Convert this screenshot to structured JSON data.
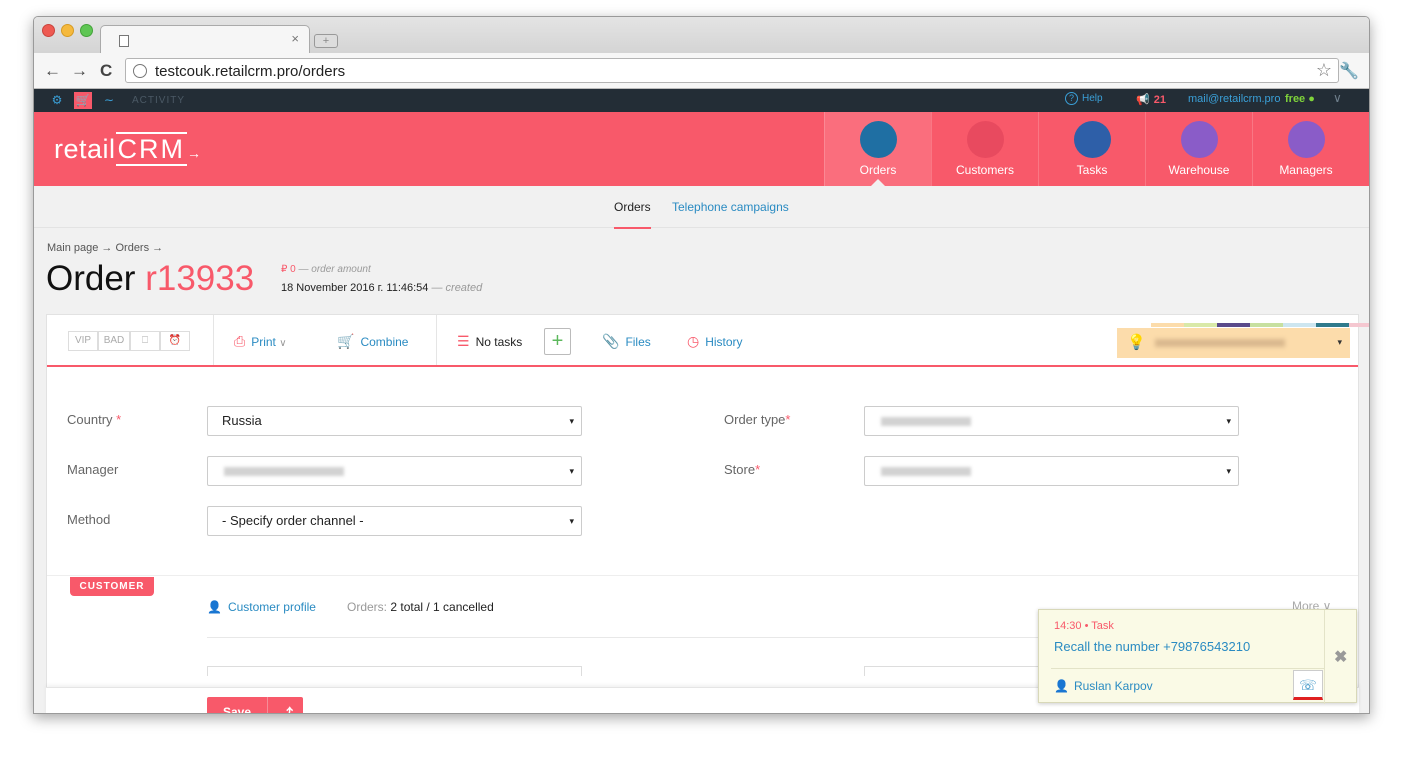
{
  "browser": {
    "url": "testcouk.retailcrm.pro/orders",
    "tab_close": "×",
    "new_tab": "+",
    "back": "←",
    "forward": "→",
    "reload": "C",
    "star": "☆",
    "wrench": "🔧"
  },
  "topstrip": {
    "settings": "⚙",
    "cart": "🛒",
    "stats": "∼",
    "activity": "ACTIVITY",
    "help_icon": "?",
    "help": "Help",
    "notif_icon": "📢",
    "notifications": "21",
    "email": "mail@retailcrm.pro",
    "plan": "free ●",
    "chevron": "∨"
  },
  "header": {
    "logo_a": "retail",
    "logo_b": "CRM",
    "logo_c": "→",
    "menu": [
      {
        "label": "Orders",
        "color": "#1f6fa3"
      },
      {
        "label": "Customers",
        "color": "#e84a5f"
      },
      {
        "label": "Tasks",
        "color": "#2e5fa8"
      },
      {
        "label": "Warehouse",
        "color": "#8a5cc8"
      },
      {
        "label": "Managers",
        "color": "#8a5cc8"
      }
    ]
  },
  "subnav": {
    "orders": "Orders",
    "campaigns": "Telephone campaigns"
  },
  "breadcrumb": "Main page → Orders →",
  "order": {
    "title_prefix": "Order",
    "number": "r13933",
    "amount": "₽ 0",
    "amount_label": "— order amount",
    "created": "18 November 2016 г. 11:46:54",
    "created_label": "— created"
  },
  "toolbar": {
    "vip": "VIP",
    "bad": "BAD",
    "print_icon": "⎙",
    "print": "Print",
    "print_arrow": "∨",
    "combine_icon": "🛒",
    "combine": "Combine",
    "tasks_icon": "☰",
    "tasks": "No tasks",
    "add": "+",
    "files_icon": "📎",
    "files": "Files",
    "history_icon": "◷",
    "history": "History",
    "manager_arrow": "▾",
    "palette": [
      "#fcdcab",
      "#d9e9a8",
      "#5a4a8a",
      "#c7e0a0",
      "#cde6f0",
      "#2f7a8c",
      "#f5c7d0"
    ]
  },
  "form": {
    "country_label": "Country",
    "country_value": "Russia",
    "manager_label": "Manager",
    "method_label": "Method",
    "method_value": "- Specify order channel -",
    "order_type_label": "Order type",
    "store_label": "Store",
    "required": "*",
    "select_arrow": "▾"
  },
  "customer": {
    "badge": "CUSTOMER",
    "profile_icon": "👤",
    "profile": "Customer profile",
    "orders_label": "Orders:",
    "orders_value": "2 total / 1 cancelled",
    "more": "More ∨"
  },
  "bottom": {
    "save": "Save",
    "save_up": "⤴"
  },
  "notification": {
    "time": "14:30 • Task",
    "text": "Recall the number +79876543210",
    "person_icon": "👤",
    "person": "Ruslan Karpov",
    "call_icon": "☏",
    "close": "✖"
  }
}
